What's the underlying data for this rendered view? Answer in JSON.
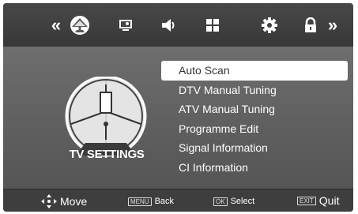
{
  "topbar": {
    "left_arrow": "«",
    "right_arrow": "»",
    "icons": [
      "satellite-dish-icon",
      "picture-icon",
      "speaker-icon",
      "grid-icon",
      "gear-icon",
      "lock-icon"
    ]
  },
  "main": {
    "title": "TV SETTINGS",
    "menu": [
      {
        "label": "Auto Scan",
        "selected": true
      },
      {
        "label": "DTV Manual Tuning",
        "selected": false
      },
      {
        "label": "ATV Manual Tuning",
        "selected": false
      },
      {
        "label": "Programme Edit",
        "selected": false
      },
      {
        "label": "Signal Information",
        "selected": false
      },
      {
        "label": "CI Information",
        "selected": false
      }
    ]
  },
  "bottombar": {
    "move_label": "Move",
    "back_key": "MENU",
    "back_label": "Back",
    "select_key": "OK",
    "select_label": "Select",
    "quit_key": "EXIT",
    "quit_label": "Quit"
  }
}
